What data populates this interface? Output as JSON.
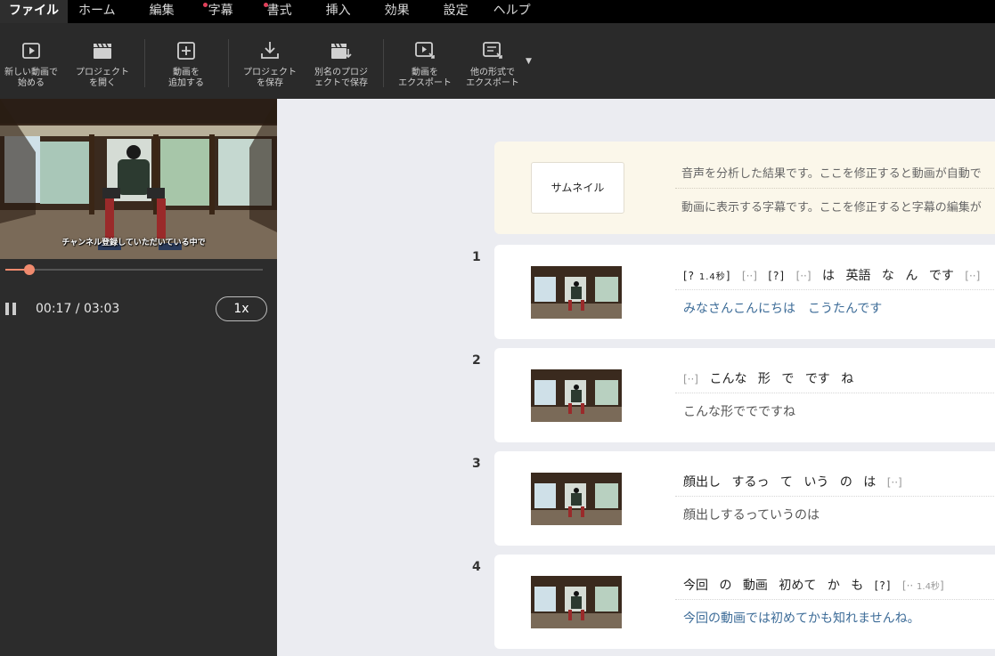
{
  "menu": [
    {
      "label": "ファイル",
      "active": true,
      "dot": false
    },
    {
      "label": "ホーム",
      "active": false,
      "dot": false
    },
    {
      "label": "編集",
      "active": false,
      "dot": false
    },
    {
      "label": "字幕",
      "active": false,
      "dot": true
    },
    {
      "label": "書式",
      "active": false,
      "dot": true
    },
    {
      "label": "挿入",
      "active": false,
      "dot": false
    },
    {
      "label": "効果",
      "active": false,
      "dot": false
    },
    {
      "label": "設定",
      "active": false,
      "dot": false
    },
    {
      "label": "ヘルプ",
      "active": false,
      "dot": false
    }
  ],
  "toolbar": {
    "new_video": {
      "line1": "新しい動画で",
      "line2": "始める",
      "icon": "play-square-icon"
    },
    "open_project": {
      "line1": "プロジェクト",
      "line2": "を開く",
      "icon": "clapper-icon"
    },
    "add_video": {
      "line1": "動画を",
      "line2": "追加する",
      "icon": "plus-square-icon"
    },
    "save_project": {
      "line1": "プロジェクト",
      "line2": "を保存",
      "icon": "download-icon"
    },
    "save_as": {
      "line1": "別名のプロジ",
      "line2": "ェクトで保存",
      "icon": "clapper-download-icon"
    },
    "export_video": {
      "line1": "動画を",
      "line2": "エクスポート",
      "icon": "export-video-icon"
    },
    "export_other": {
      "line1": "他の形式で",
      "line2": "エクスポート",
      "icon": "export-doc-icon"
    },
    "more": "▼"
  },
  "player": {
    "caption": "チャンネル登録していただいている中で",
    "time": "00:17 / 03:03",
    "progress": 0.093,
    "speed": "1x"
  },
  "header_card": {
    "thumbnail_label": "サムネイル",
    "line1": "音声を分析した結果です。ここを修正すると動画が自動で",
    "line2": "動画に表示する字幕です。ここを修正すると字幕の編集が"
  },
  "segments": [
    {
      "num": "1",
      "words": [
        "[? 1.4秒]",
        "[··]",
        "[?]",
        "[··]",
        "は",
        "英語",
        "な",
        "ん",
        "です",
        "[··]"
      ],
      "subtitle": "みなさんこんにちは　こうたんです",
      "subtitle_color": "#3d6c98"
    },
    {
      "num": "2",
      "words": [
        "[··]",
        "こんな",
        "形",
        "で",
        "です",
        "ね"
      ],
      "subtitle": "こんな形ででですね",
      "subtitle_color": "#555555"
    },
    {
      "num": "3",
      "words": [
        "顔出し",
        "するっ",
        "て",
        "いう",
        "の",
        "は",
        "[··]"
      ],
      "subtitle": "顔出しするっていうのは",
      "subtitle_color": "#555555"
    },
    {
      "num": "4",
      "words": [
        "今回",
        "の",
        "動画",
        "初めて",
        "か",
        "も",
        "[?]",
        "[·· 1.4秒]"
      ],
      "subtitle": "今回の動画では初めてかも知れませんね。",
      "subtitle_color": "#3d6c98"
    }
  ]
}
